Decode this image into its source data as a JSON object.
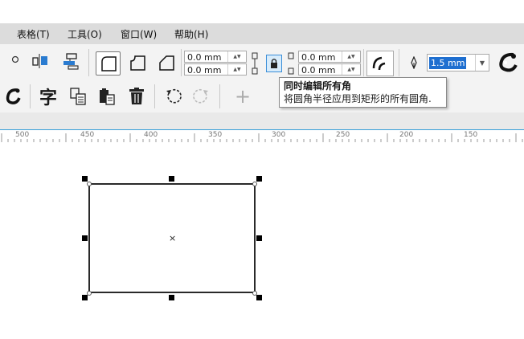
{
  "menu": {
    "items": [
      "表格(T)",
      "工具(O)",
      "窗口(W)",
      "帮助(H)"
    ]
  },
  "propbar": {
    "corner_radius_top_left": "0.0 mm",
    "corner_radius_bottom_left": "0.0 mm",
    "corner_radius_top_right": "0.0 mm",
    "corner_radius_bottom_right": "0.0 mm",
    "outline_width": "1.5 mm"
  },
  "tooltip": {
    "title": "同时编辑所有角",
    "description": "将圆角半径应用到矩形的所有圆角."
  },
  "ruler": {
    "labels": [
      "500",
      "450",
      "400",
      "350",
      "300",
      "250",
      "200",
      "150"
    ]
  },
  "canvas": {
    "center_mark": "×"
  },
  "toolbar2": {
    "text_glyph": "字",
    "add_glyph": "+"
  },
  "colors": {
    "selection_highlight": "#1f6fd0",
    "ruler_accent": "#3aa0d8",
    "menubar_bg": "#dcdcdc"
  }
}
